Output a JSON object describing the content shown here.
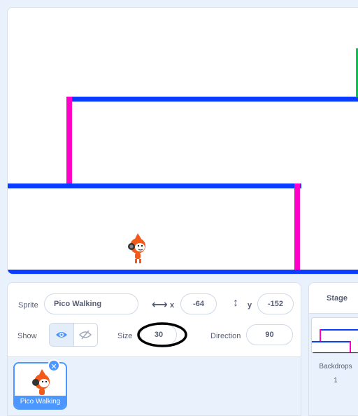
{
  "stage": {
    "colors": {
      "platform": "#0a3cff",
      "wall": "#ff00c8",
      "goal": "#00c853"
    },
    "sprite": {
      "icon": "pico-walking-sprite"
    }
  },
  "sprite_info": {
    "sprite_label": "Sprite",
    "sprite_name": "Pico Walking",
    "x_label": "x",
    "x_value": "-64",
    "y_label": "y",
    "y_value": "-152",
    "show_label": "Show",
    "size_label": "Size",
    "size_value": "30",
    "direction_label": "Direction",
    "direction_value": "90"
  },
  "sprite_list": {
    "items": [
      {
        "name": "Pico Walking",
        "selected": true
      }
    ],
    "delete_glyph": "✕"
  },
  "stage_panel": {
    "title": "Stage",
    "backdrops_label": "Backdrops",
    "backdrops_count": "1"
  },
  "annotation": {
    "color": "#000000",
    "target": "size-field"
  },
  "accent_color": "#4c97ff"
}
